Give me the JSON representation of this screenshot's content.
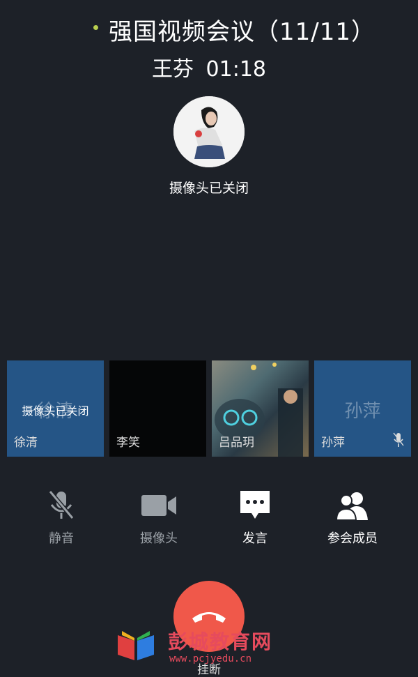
{
  "header": {
    "meeting_title": "强国视频会议（11/11）",
    "speaker_name": "王芬",
    "call_duration": "01:18"
  },
  "main_video": {
    "camera_status": "摄像头已关闭"
  },
  "participants": [
    {
      "name": "徐清",
      "placeholder_name": "徐清",
      "status": "摄像头已关闭"
    },
    {
      "name": "李笑"
    },
    {
      "name": "吕品玥"
    },
    {
      "name": "孙萍",
      "placeholder_name": "孙萍",
      "mic_icon": "microphone-icon"
    }
  ],
  "controls": [
    {
      "label": "静音",
      "icon": "mic-muted-icon"
    },
    {
      "label": "摄像头",
      "icon": "video-camera-icon"
    },
    {
      "label": "发言",
      "icon": "chat-bubble-icon"
    },
    {
      "label": "参会成员",
      "icon": "members-icon"
    }
  ],
  "hangup": {
    "label": "挂断",
    "icon": "phone-hangup-icon",
    "color": "#f0584a"
  },
  "watermark": {
    "name": "彭城教育网",
    "url": "www.pcjyedu.cn"
  },
  "colors": {
    "background": "#1d2128",
    "tile_blue": "#255586",
    "status_dot": "#b9cf4f"
  }
}
